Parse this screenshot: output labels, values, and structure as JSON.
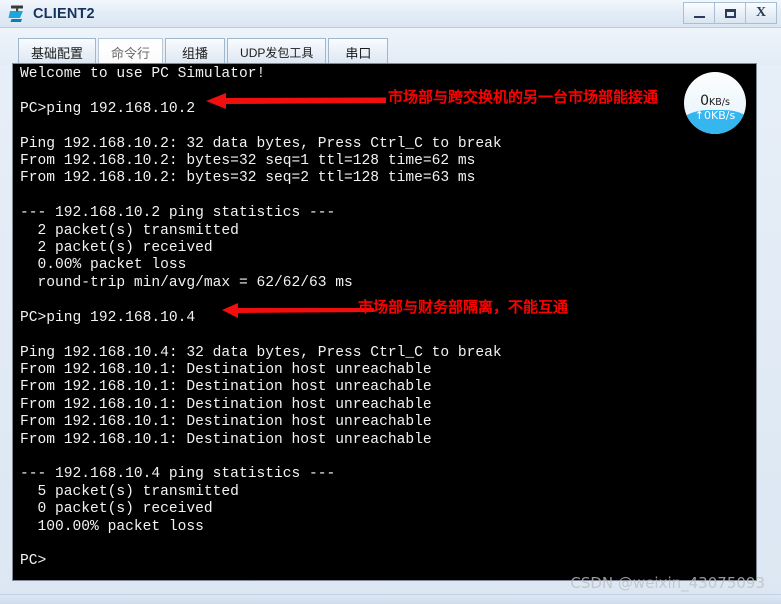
{
  "window": {
    "title": "CLIENT2",
    "icon": "pc-terminal-icon",
    "buttons": {
      "minimize": "minimize-icon",
      "maximize": "maximize-icon",
      "close": "X"
    }
  },
  "tabs": [
    {
      "label": "基础配置",
      "active": false
    },
    {
      "label": "命令行",
      "active": true
    },
    {
      "label": "组播",
      "active": false
    },
    {
      "label": "UDP发包工具",
      "active": false
    },
    {
      "label": "串口",
      "active": false
    }
  ],
  "terminal": {
    "text": "Welcome to use PC Simulator!\n\nPC>ping 192.168.10.2\n\nPing 192.168.10.2: 32 data bytes, Press Ctrl_C to break\nFrom 192.168.10.2: bytes=32 seq=1 ttl=128 time=62 ms\nFrom 192.168.10.2: bytes=32 seq=2 ttl=128 time=63 ms\n\n--- 192.168.10.2 ping statistics ---\n  2 packet(s) transmitted\n  2 packet(s) received\n  0.00% packet loss\n  round-trip min/avg/max = 62/62/63 ms\n\nPC>ping 192.168.10.4\n\nPing 192.168.10.4: 32 data bytes, Press Ctrl_C to break\nFrom 192.168.10.1: Destination host unreachable\nFrom 192.168.10.1: Destination host unreachable\nFrom 192.168.10.1: Destination host unreachable\nFrom 192.168.10.1: Destination host unreachable\nFrom 192.168.10.1: Destination host unreachable\n\n--- 192.168.10.4 ping statistics ---\n  5 packet(s) transmitted\n  0 packet(s) received\n  100.00% packet loss\n\nPC>",
    "prompt": "PC>",
    "commands": [
      "ping 192.168.10.2",
      "ping 192.168.10.4"
    ],
    "ping_results": [
      {
        "target": "192.168.10.2",
        "data_bytes": 32,
        "break_hint": "Press Ctrl_C to break",
        "replies": [
          {
            "from": "192.168.10.2",
            "bytes": 32,
            "seq": 1,
            "ttl": 128,
            "time_ms": 62
          },
          {
            "from": "192.168.10.2",
            "bytes": 32,
            "seq": 2,
            "ttl": 128,
            "time_ms": 63
          }
        ],
        "transmitted": 2,
        "received": 2,
        "packet_loss": "0.00%",
        "round_trip": "62/62/63 ms"
      },
      {
        "target": "192.168.10.4",
        "data_bytes": 32,
        "break_hint": "Press Ctrl_C to break",
        "replies": [
          {
            "from": "192.168.10.1",
            "message": "Destination host unreachable"
          },
          {
            "from": "192.168.10.1",
            "message": "Destination host unreachable"
          },
          {
            "from": "192.168.10.1",
            "message": "Destination host unreachable"
          },
          {
            "from": "192.168.10.1",
            "message": "Destination host unreachable"
          },
          {
            "from": "192.168.10.1",
            "message": "Destination host unreachable"
          }
        ],
        "transmitted": 5,
        "received": 0,
        "packet_loss": "100.00%"
      }
    ]
  },
  "annotations": [
    {
      "text": "市场部与跨交换机的另一台市场部能接通",
      "color": "#ff0000",
      "arrow": "left-arrow"
    },
    {
      "text": "市场部与财务部隔离，不能互通",
      "color": "#ff0000",
      "arrow": "left-arrow"
    }
  ],
  "netspeed": {
    "download": "0",
    "download_unit": "KB/s",
    "upload": "↑0KB/s"
  },
  "watermark": "CSDN @weixin_43075093"
}
